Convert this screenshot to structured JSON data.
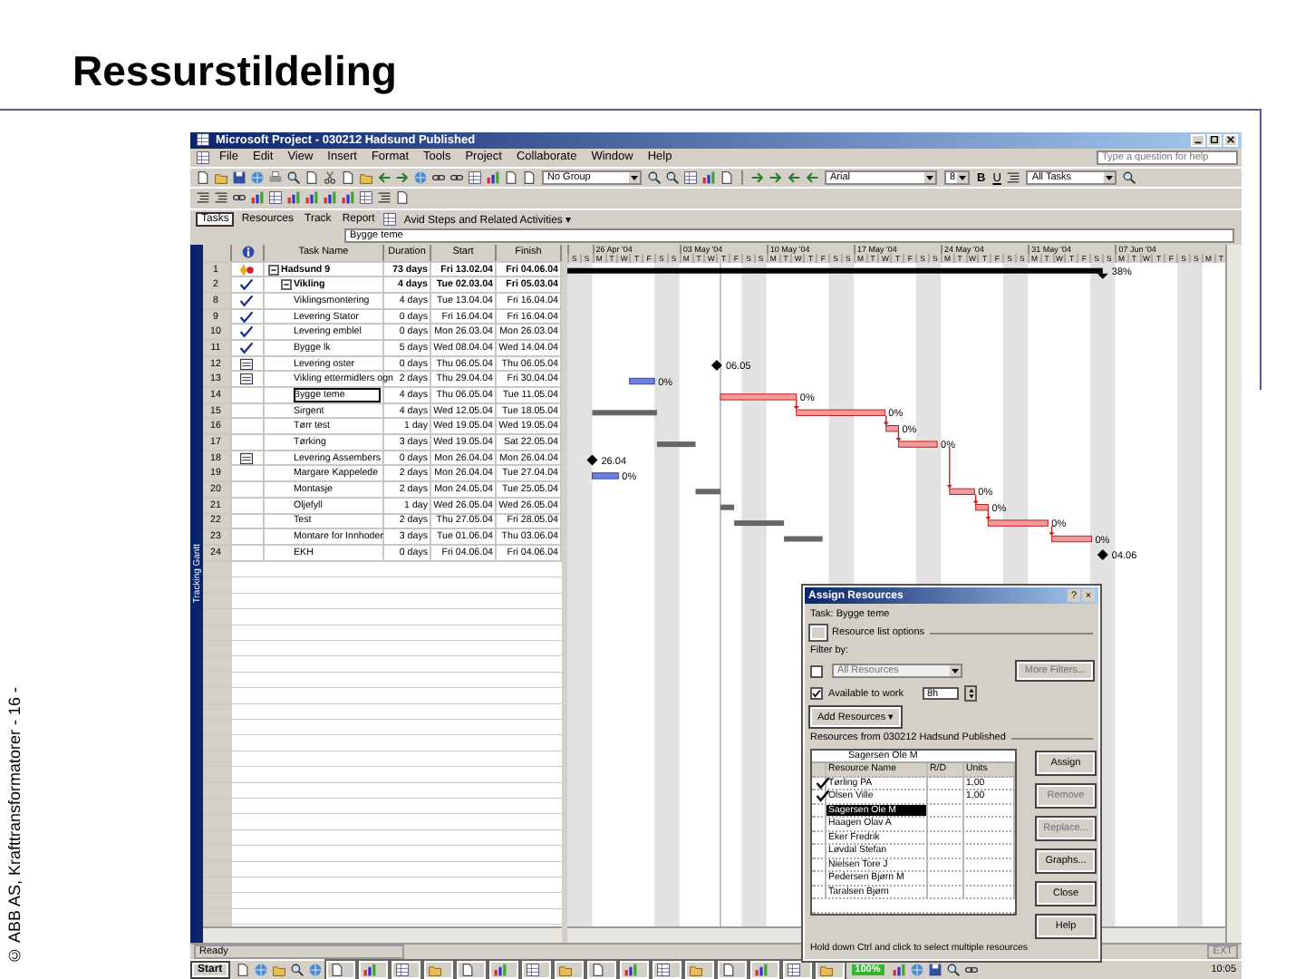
{
  "slide": {
    "title": "Ressurstildeling",
    "footer": "© ABB AS, Krafttransformatorer - 16 -"
  },
  "window": {
    "title": "Microsoft Project - 030212 Hadsund Published"
  },
  "menu": [
    "File",
    "Edit",
    "View",
    "Insert",
    "Format",
    "Tools",
    "Project",
    "Collaborate",
    "Window",
    "Help"
  ],
  "help_search": {
    "placeholder": "Type a question for help"
  },
  "toolbar": {
    "group": "No Group",
    "font": "Arial",
    "size": "8",
    "bold": "B",
    "underline": "U",
    "filter": "All Tasks"
  },
  "guide_bar": {
    "tabs": [
      {
        "label": "Tasks",
        "selected": true
      },
      {
        "label": "Resources",
        "selected": false
      },
      {
        "label": "Track",
        "selected": false
      },
      {
        "label": "Report",
        "selected": false
      }
    ],
    "activity": "Avid Steps and Related Activities ▾"
  },
  "entry_bar": {
    "value": "Bygge teme"
  },
  "view_bar": {
    "label": "Tracking Gantt"
  },
  "table": {
    "columns": [
      "Task Name",
      "Duration",
      "Start",
      "Finish"
    ],
    "tasks": [
      {
        "id": "1",
        "flagged": true,
        "complete": false,
        "note": false,
        "name": "Hadsund 9",
        "duration": "73 days",
        "start": "Fri 13.02.04",
        "finish": "Fri 04.06.04",
        "selected": false,
        "kind": "summary",
        "bar_label": "38%",
        "expanded": true,
        "children": [
          {
            "id": "2",
            "flagged": false,
            "complete": true,
            "note": false,
            "name": "Vikling",
            "duration": "4 days",
            "start": "Tue 02.03.04",
            "finish": "Fri 05.03.04",
            "selected": false,
            "kind": "summary",
            "expanded": true,
            "children": [
              {
                "id": "8",
                "flagged": false,
                "complete": true,
                "note": false,
                "name": "Viklingsmontering",
                "duration": "4 days",
                "start": "Tue 13.04.04",
                "finish": "Fri 16.04.04",
                "selected": false
              },
              {
                "id": "9",
                "flagged": false,
                "complete": true,
                "note": false,
                "name": "Levering Stator",
                "duration": "0 days",
                "start": "Fri 16.04.04",
                "finish": "Fri 16.04.04",
                "selected": false
              },
              {
                "id": "10",
                "flagged": false,
                "complete": true,
                "note": false,
                "name": "Levering emblel",
                "duration": "0 days",
                "start": "Mon 26.03.04",
                "finish": "Mon 26.03.04",
                "selected": false
              },
              {
                "id": "11",
                "flagged": false,
                "complete": true,
                "note": false,
                "name": "Bygge lk",
                "duration": "5 days",
                "start": "Wed 08.04.04",
                "finish": "Wed 14.04.04",
                "selected": false
              },
              {
                "id": "12",
                "flagged": false,
                "complete": false,
                "note": true,
                "name": "Levering oster",
                "duration": "0 days",
                "start": "Thu 06.05.04",
                "finish": "Thu 06.05.04",
                "selected": false,
                "kind": "milestone",
                "bar_label": "06.05"
              },
              {
                "id": "13",
                "flagged": false,
                "complete": false,
                "note": true,
                "name": "Vikling ettermidlers ogn",
                "duration": "2 days",
                "start": "Thu 29.04.04",
                "finish": "Fri 30.04.04",
                "selected": false,
                "kind": "task",
                "bar_label": "0%"
              },
              {
                "id": "14",
                "flagged": false,
                "complete": false,
                "note": false,
                "name": "Bygge teme",
                "duration": "4 days",
                "start": "Thu 06.05.04",
                "finish": "Tue 11.05.04",
                "selected": true,
                "kind": "critical",
                "bar_label": "0%"
              },
              {
                "id": "15",
                "flagged": false,
                "complete": false,
                "note": false,
                "name": "Sirgent",
                "duration": "4 days",
                "start": "Wed 12.05.04",
                "finish": "Tue 18.05.04",
                "selected": false,
                "kind": "critical",
                "bar_label": "0%"
              },
              {
                "id": "16",
                "flagged": false,
                "complete": false,
                "note": false,
                "name": "Tørr test",
                "duration": "1 day",
                "start": "Wed 19.05.04",
                "finish": "Wed 19.05.04",
                "selected": false,
                "kind": "critical",
                "bar_label": "0%"
              },
              {
                "id": "17",
                "flagged": false,
                "complete": false,
                "note": false,
                "name": "Tørking",
                "duration": "3 days",
                "start": "Wed 19.05.04",
                "finish": "Sat 22.05.04",
                "selected": false,
                "kind": "critical",
                "bar_label": "0%"
              },
              {
                "id": "18",
                "flagged": false,
                "complete": false,
                "note": true,
                "name": "Levering Assembers",
                "duration": "0 days",
                "start": "Mon 26.04.04",
                "finish": "Mon 26.04.04",
                "selected": false,
                "kind": "milestone",
                "bar_label": "26.04"
              },
              {
                "id": "19",
                "flagged": false,
                "complete": false,
                "note": false,
                "name": "Margare Kappelede",
                "duration": "2 days",
                "start": "Mon 26.04.04",
                "finish": "Tue 27.04.04",
                "selected": false,
                "kind": "task",
                "bar_label": "0%"
              },
              {
                "id": "20",
                "flagged": false,
                "complete": false,
                "note": false,
                "name": "Montasje",
                "duration": "2 days",
                "start": "Mon 24.05.04",
                "finish": "Tue 25.05.04",
                "selected": false,
                "kind": "critical",
                "bar_label": "0%"
              },
              {
                "id": "21",
                "flagged": false,
                "complete": false,
                "note": false,
                "name": "Oljefyll",
                "duration": "1 day",
                "start": "Wed 26.05.04",
                "finish": "Wed 26.05.04",
                "selected": false,
                "kind": "critical",
                "bar_label": "0%"
              },
              {
                "id": "22",
                "flagged": false,
                "complete": false,
                "note": false,
                "name": "Test",
                "duration": "2 days",
                "start": "Thu 27.05.04",
                "finish": "Fri 28.05.04",
                "selected": false,
                "kind": "critical",
                "bar_label": "0%"
              },
              {
                "id": "23",
                "flagged": false,
                "complete": false,
                "note": false,
                "name": "Montare for Innhoder",
                "duration": "3 days",
                "start": "Tue 01.06.04",
                "finish": "Thu 03.06.04",
                "selected": false,
                "kind": "critical",
                "bar_label": "0%"
              },
              {
                "id": "24",
                "flagged": false,
                "complete": false,
                "note": false,
                "name": "EKH",
                "duration": "0 days",
                "start": "Fri 04.06.04",
                "finish": "Fri 04.06.04",
                "selected": false,
                "kind": "milestone",
                "bar_label": "04.06"
              }
            ]
          }
        ]
      }
    ]
  },
  "gantt": {
    "weeks": [
      "26 Apr '04",
      "03 May '04",
      "10 May '04",
      "17 May '04",
      "24 May '04",
      "31 May '04",
      "07 Jun '04"
    ],
    "days": [
      "S",
      "S",
      "M",
      "T",
      "W",
      "T",
      "F",
      "S",
      "S",
      "M",
      "T",
      "W",
      "T",
      "F",
      "S",
      "S",
      "M",
      "T",
      "W",
      "T",
      "F",
      "S",
      "S",
      "M",
      "T",
      "W",
      "T",
      "F",
      "S",
      "S",
      "M",
      "T",
      "W",
      "T",
      "F",
      "S",
      "S",
      "M",
      "T",
      "W",
      "T",
      "F",
      "S",
      "S",
      "M",
      "T",
      "W",
      "T",
      "F",
      "S",
      "S",
      "M",
      "T"
    ]
  },
  "assign_resources": {
    "title": "Assign Resources",
    "title_buttons": [
      "?",
      "×"
    ],
    "task": "Task: Bygge teme",
    "options_toggle": "Resource list options",
    "filter_label": "Filter by:",
    "filter_checked": false,
    "filter_value": "All Resources",
    "more_filters": "More Filters...",
    "available_checked": true,
    "available_label": "Available to work",
    "available_value": "8h",
    "add_resources": "Add Resources ▾",
    "resources_from": "Resources from 030212 Hadsund Published",
    "entry": "Sagersen Ole M",
    "columns": [
      "Resource Name",
      "R/D",
      "Units"
    ],
    "resources": [
      {
        "name": "Tørling PA",
        "units": "1,00",
        "assigned": true,
        "selected": false
      },
      {
        "name": "Olsen Ville",
        "units": "1,00",
        "assigned": true,
        "selected": false
      },
      {
        "name": "Sagersen Ole M",
        "assigned": false,
        "selected": true
      },
      {
        "name": "Haagen Olav A",
        "assigned": false,
        "selected": false
      },
      {
        "name": "Eker Fredrik",
        "assigned": false,
        "selected": false
      },
      {
        "name": "Løvdal Stefan",
        "assigned": false,
        "selected": false
      },
      {
        "name": "Nielsen Tore J",
        "assigned": false,
        "selected": false
      },
      {
        "name": "Pedersen Bjørn M",
        "assigned": false,
        "selected": false
      },
      {
        "name": "Taralsen Bjørn",
        "assigned": false,
        "selected": false
      }
    ],
    "buttons": [
      {
        "label": "Assign",
        "disabled": false
      },
      {
        "label": "Remove",
        "disabled": true
      },
      {
        "label": "Replace...",
        "disabled": true
      },
      {
        "label": "Graphs...",
        "disabled": false
      },
      {
        "label": "Close",
        "disabled": false
      },
      {
        "label": "Help",
        "disabled": false
      }
    ],
    "hint": "Hold down Ctrl and click to select multiple resources"
  },
  "status_bar": {
    "status": "Ready",
    "indicator": "EXT"
  },
  "taskbar": {
    "start": "Start",
    "zoom": "100%",
    "clock": "10:05"
  }
}
